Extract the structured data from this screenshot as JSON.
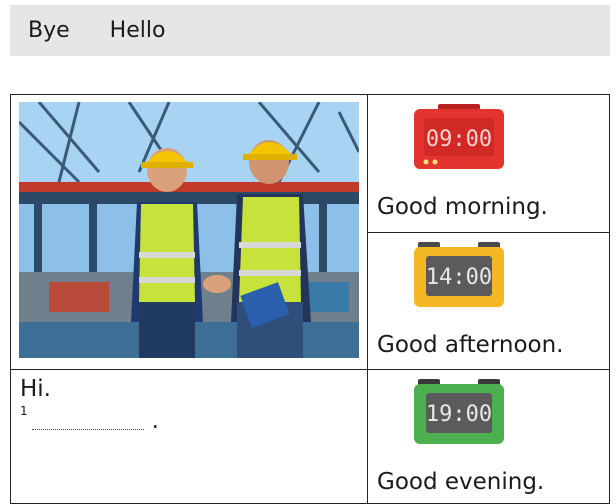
{
  "word_bank": [
    "Bye",
    "Hello"
  ],
  "clocks": [
    {
      "time": "09:00",
      "caption": "Good morning.",
      "color": "#e3342f"
    },
    {
      "time": "14:00",
      "caption": "Good afternoon.",
      "color": "#f3b824"
    },
    {
      "time": "19:00",
      "caption": "Good evening.",
      "color": "#4caf50"
    }
  ],
  "dialog": {
    "line1": "Hi.",
    "number": "1",
    "end": "."
  }
}
